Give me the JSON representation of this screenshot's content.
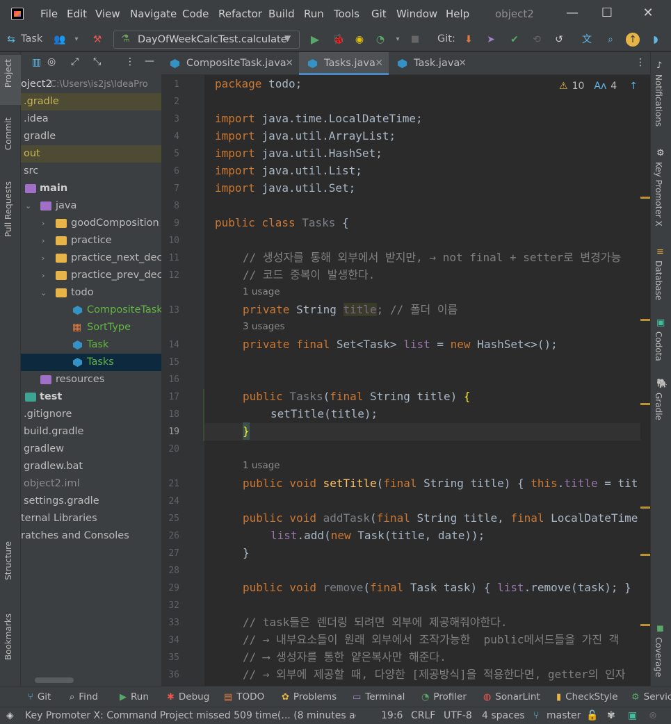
{
  "titlebar": {
    "menu": [
      "File",
      "Edit",
      "View",
      "Navigate",
      "Code",
      "Refactor",
      "Build",
      "Run",
      "Tools",
      "Git",
      "Window",
      "Help"
    ],
    "project_title": "object2"
  },
  "toolbar": {
    "project_label": "Task",
    "run_config": "DayOfWeekCalcTest.calculate",
    "git_label": "Git:"
  },
  "left_strip": {
    "project": "Project",
    "commit": "Commit",
    "pull_requests": "Pull Requests",
    "structure": "Structure",
    "bookmarks": "Bookmarks"
  },
  "right_strip": {
    "notifications": "Notifications",
    "key_promoter": "Key Promoter X",
    "database": "Database",
    "codota": "Codota",
    "gradle": "Gradle",
    "coverage": "Coverage"
  },
  "project_tree": {
    "root_name": "oject2",
    "root_path": "C:\\Users\\is2js\\IdeaPro",
    "items": [
      {
        "label": ".gradle"
      },
      {
        "label": ".idea"
      },
      {
        "label": "gradle"
      },
      {
        "label": "out"
      },
      {
        "label": "src"
      },
      {
        "label": "main"
      },
      {
        "label": "java"
      },
      {
        "label": "goodComposition"
      },
      {
        "label": "practice"
      },
      {
        "label": "practice_next_deco_"
      },
      {
        "label": "practice_prev_deco_"
      },
      {
        "label": "todo"
      },
      {
        "label": "CompositeTask"
      },
      {
        "label": "SortType"
      },
      {
        "label": "Task"
      },
      {
        "label": "Tasks"
      },
      {
        "label": "resources"
      },
      {
        "label": "test"
      },
      {
        "label": ".gitignore"
      },
      {
        "label": "build.gradle"
      },
      {
        "label": "gradlew"
      },
      {
        "label": "gradlew.bat"
      },
      {
        "label": "object2.iml"
      },
      {
        "label": "settings.gradle"
      },
      {
        "label": "ternal Libraries"
      },
      {
        "label": "ratches and Consoles"
      }
    ]
  },
  "tabs": [
    {
      "label": "CompositeTask.java"
    },
    {
      "label": "Tasks.java"
    },
    {
      "label": "Task.java"
    }
  ],
  "inspections": {
    "warnings": "10",
    "typos": "4"
  },
  "line_numbers": [
    "1",
    "2",
    "3",
    "4",
    "5",
    "6",
    "7",
    "8",
    "9",
    "10",
    "11",
    "12",
    "13",
    "14",
    "15",
    "16",
    "17",
    "18",
    "19",
    "20",
    "21",
    "24",
    "25",
    "26",
    "27",
    "28",
    "29",
    "32",
    "33",
    "34",
    "35",
    "36"
  ],
  "code": {
    "l1a": "package",
    "l1b": " todo;",
    "l3": "java.time.LocalDateTime;",
    "l4": "java.util.ArrayList;",
    "l5": "java.util.HashSet;",
    "l6": "java.util.List;",
    "l7": "java.util.Set;",
    "import_kw": "import",
    "l9a": "public class",
    "l9b": "Tasks",
    "l9c": " {",
    "l11": "// 생성자를 통해 외부에서 받지만, → not final + setter로 변경가능",
    "l12": "// 코드 중복이 발생한다.",
    "usage1": "1 usage",
    "l13a": "private",
    "l13b": " String ",
    "l13c": "title",
    "l13d": "; // 폴더 이름",
    "usage3": "3 usages",
    "l14a": "private final",
    "l14b": " Set<Task> ",
    "l14c": "list",
    "l14d": " = ",
    "l14e": "new",
    "l14f": " HashSet<>();",
    "l17a": "public",
    "l17b": " Tasks",
    "l17c": "(",
    "l17d": "final",
    "l17e": " String title) ",
    "l17f": "{",
    "l18": "setTitle(title);",
    "l19": "}",
    "usage1b": "1 usage",
    "l21a": "public void",
    "l21b": " setTitle",
    "l21c": "(",
    "l21d": "final",
    "l21e": " String title) { ",
    "l21f": "this",
    "l21g": ".",
    "l21h": "title",
    "l21i": " = tit",
    "l25a": "public void",
    "l25b": " addTask",
    "l25c": "(",
    "l25d": "final",
    "l25e": " String title, ",
    "l25f": "final",
    "l25g": " LocalDateTime",
    "l26a": "list",
    "l26b": ".add(",
    "l26c": "new",
    "l26d": " Task(title, date));",
    "l27": "}",
    "l29a": "public void",
    "l29b": " remove",
    "l29c": "(",
    "l29d": "final",
    "l29e": " Task task) { ",
    "l29f": "list",
    "l29g": ".remove(task); }",
    "l33": "// task들은 렌더링 되려면 외부에 제공해줘야한다.",
    "l34": "// → 내부요소들이 원래 외부에서 조작가능한  public메서드들을 가진 객",
    "l35": "// ⟶ 생성자를 통한 얕은복사만 해준다.",
    "l36": "// → 외부에 제공할 때, 다양한 [제공방식]을 적용한다면, getter의 인자"
  },
  "bottom_tools": [
    "Git",
    "Find",
    "Run",
    "Debug",
    "TODO",
    "Problems",
    "Terminal",
    "Profiler",
    "SonarLint",
    "CheckStyle",
    "Servic"
  ],
  "status": {
    "message": "Key Promoter X: Command Project missed 509 time(... (8 minutes agc",
    "position": "19:6",
    "line_sep": "CRLF",
    "encoding": "UTF-8",
    "indent": "4 spaces",
    "branch": "master"
  },
  "colors": {
    "accent": "#4a88c7",
    "selected_row": "#0d293e",
    "excluded": "#4d4b33"
  }
}
